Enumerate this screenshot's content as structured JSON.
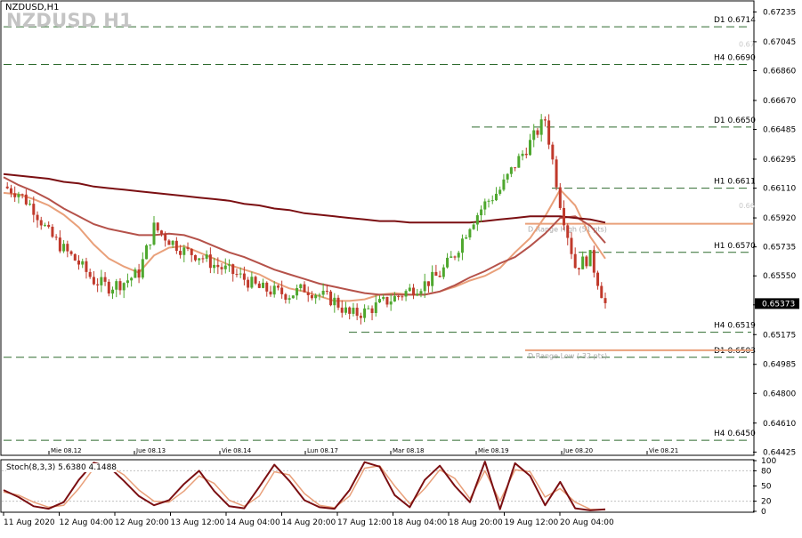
{
  "header": {
    "symbol_tf": "NZDUSD,H1",
    "title": "NZDUSD H1"
  },
  "colors": {
    "bull": "#4ea72e",
    "bear": "#c0392b",
    "ma_fast": "#e9a07a",
    "ma_mid": "#b5524a",
    "ma_slow": "#7b0f12",
    "level_line": "#2e6b2e",
    "range": "#e9a07a",
    "stoch_main": "#7b0f12",
    "stoch_signal": "#e9a07a",
    "price_tag_bg": "#000000"
  },
  "chart_data": [
    {
      "type": "candlestick",
      "title": "NZDUSD H1",
      "ylim": [
        0.6441,
        0.673
      ],
      "y_ticks": [
        "0.67235",
        "0.67045",
        "0.66860",
        "0.66670",
        "0.66485",
        "0.66295",
        "0.66110",
        "0.65920",
        "0.65735",
        "0.65550",
        "0.65365",
        "0.65175",
        "0.64985",
        "0.64800",
        "0.64610",
        "0.64425"
      ],
      "x_top_labels": [
        "Mie 08.12",
        "Jue 08.13",
        "Vie 08.14",
        "Lun 08.17",
        "Mar 08.18",
        "Mie 08.19",
        "Jue 08.20",
        "Vie 08.21"
      ],
      "current_price": "0.65373",
      "levels": [
        {
          "label": "D1 0.6714",
          "value": 0.6714
        },
        {
          "label": "H4 0.6690",
          "value": 0.669
        },
        {
          "label": "D1 0.6650",
          "value": 0.665
        },
        {
          "label": "H1 0.6611",
          "value": 0.6611
        },
        {
          "label": "H1 0.6570",
          "value": 0.657
        },
        {
          "label": "H4 0.6519",
          "value": 0.6519
        },
        {
          "label": "D1 0.6503",
          "value": 0.6503
        },
        {
          "label": "H4 0.6450",
          "value": 0.645
        }
      ],
      "faint_labels": [
        {
          "text": "0.67",
          "value": 0.6703
        },
        {
          "text": "0.66",
          "value": 0.66
        }
      ],
      "range": {
        "high_label": "D Range High (51 pts)",
        "high_value": 0.65883,
        "low_label": "D Range Low (-32 pts)",
        "low_value": 0.65075
      },
      "series": [
        {
          "name": "MA fast",
          "values": [
            0.6608,
            0.6607,
            0.6604,
            0.66,
            0.6594,
            0.6586,
            0.6575,
            0.6566,
            0.6561,
            0.6557,
            0.6568,
            0.6573,
            0.6574,
            0.657,
            0.6566,
            0.6562,
            0.6559,
            0.6556,
            0.6551,
            0.6547,
            0.6545,
            0.6542,
            0.6539,
            0.6539,
            0.654,
            0.6543,
            0.6544,
            0.6543,
            0.6543,
            0.6545,
            0.6548,
            0.6552,
            0.6555,
            0.656,
            0.657,
            0.6579,
            0.6593,
            0.661,
            0.66,
            0.658,
            0.6566
          ]
        },
        {
          "name": "MA mid",
          "values": [
            0.6618,
            0.6613,
            0.6609,
            0.6604,
            0.6598,
            0.6593,
            0.6588,
            0.6585,
            0.6583,
            0.6581,
            0.6581,
            0.6582,
            0.6581,
            0.6578,
            0.6574,
            0.657,
            0.6567,
            0.6563,
            0.6559,
            0.6556,
            0.6553,
            0.655,
            0.6548,
            0.6546,
            0.6544,
            0.6543,
            0.6543,
            0.6543,
            0.6543,
            0.6545,
            0.6549,
            0.6554,
            0.6558,
            0.6563,
            0.6567,
            0.6574,
            0.6582,
            0.6592,
            0.6593,
            0.6587,
            0.6576
          ]
        },
        {
          "name": "MA slow",
          "values": [
            0.662,
            0.6619,
            0.6618,
            0.6617,
            0.6615,
            0.6614,
            0.6612,
            0.6611,
            0.661,
            0.6609,
            0.6608,
            0.6607,
            0.6606,
            0.6605,
            0.6604,
            0.6603,
            0.6601,
            0.66,
            0.6598,
            0.6597,
            0.6595,
            0.6594,
            0.6593,
            0.6592,
            0.6591,
            0.659,
            0.659,
            0.6589,
            0.6589,
            0.6589,
            0.6589,
            0.6589,
            0.659,
            0.6591,
            0.6592,
            0.6593,
            0.6593,
            0.6593,
            0.6592,
            0.6591,
            0.6589
          ]
        },
        {
          "name": "Close",
          "values": [
            0.6612,
            0.6608,
            0.6598,
            0.6582,
            0.6572,
            0.6563,
            0.6552,
            0.6548,
            0.6551,
            0.6557,
            0.6586,
            0.6578,
            0.6571,
            0.6568,
            0.6562,
            0.6558,
            0.6553,
            0.6547,
            0.6545,
            0.6543,
            0.6547,
            0.6543,
            0.6539,
            0.653,
            0.6532,
            0.6537,
            0.6541,
            0.6546,
            0.655,
            0.6556,
            0.6569,
            0.6588,
            0.6601,
            0.661,
            0.6626,
            0.664,
            0.6655,
            0.6602,
            0.6561,
            0.6567,
            0.6537
          ]
        }
      ]
    },
    {
      "type": "line",
      "title": "Stoch(8,3,3) 5.6380 4.1488",
      "ylim": [
        0,
        100
      ],
      "y_ticks": [
        "100",
        "80",
        "50",
        "20",
        "0"
      ],
      "x_labels": [
        "11 Aug 2020",
        "12 Aug 04:00",
        "12 Aug 20:00",
        "13 Aug 12:00",
        "14 Aug 04:00",
        "14 Aug 20:00",
        "17 Aug 12:00",
        "18 Aug 04:00",
        "18 Aug 20:00",
        "19 Aug 12:00",
        "20 Aug 04:00"
      ],
      "series": [
        {
          "name": "Main",
          "values": [
            42,
            28,
            10,
            5,
            18,
            62,
            96,
            88,
            60,
            30,
            12,
            22,
            54,
            80,
            40,
            10,
            6,
            48,
            92,
            60,
            22,
            8,
            5,
            42,
            97,
            88,
            32,
            8,
            62,
            90,
            50,
            18,
            98,
            4,
            95,
            70,
            12,
            58,
            6,
            2,
            4
          ]
        },
        {
          "name": "Signal",
          "values": [
            38,
            32,
            18,
            8,
            12,
            45,
            85,
            90,
            72,
            42,
            20,
            18,
            40,
            70,
            55,
            22,
            10,
            30,
            78,
            72,
            35,
            12,
            7,
            30,
            85,
            90,
            50,
            15,
            45,
            82,
            65,
            25,
            80,
            20,
            82,
            78,
            28,
            45,
            18,
            4,
            3
          ]
        }
      ]
    }
  ]
}
